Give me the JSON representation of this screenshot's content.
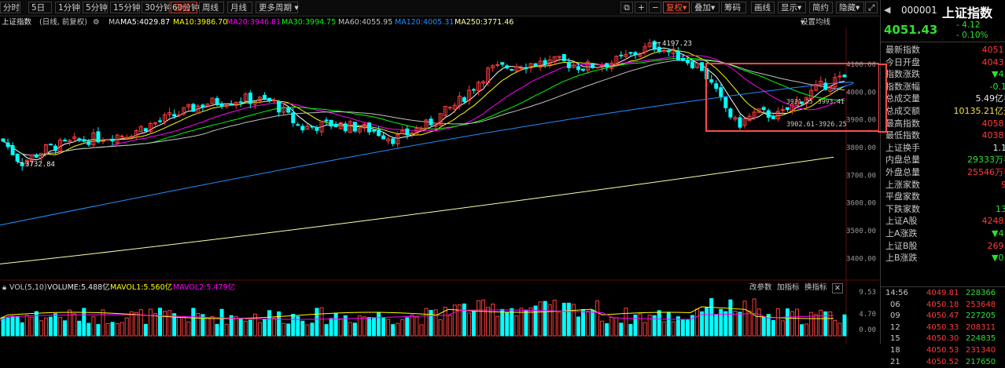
{
  "colors": {
    "up": "#ff3b3b",
    "down": "#00ffff",
    "ma5": "#ffffff",
    "ma10": "#ffff00",
    "ma20": "#ff00ff",
    "ma30": "#00ff00",
    "ma60": "#c0c0c0",
    "ma120": "#1e90ff",
    "ma250": "#ffffaa",
    "frame": "#ff4b4b"
  },
  "toolbar": {
    "periods": [
      "分时",
      "5日",
      "1分钟",
      "5分钟",
      "15分钟",
      "30分钟",
      "60分钟",
      "日线",
      "周线",
      "月线",
      "更多周期"
    ],
    "active_period": "日线",
    "right": [
      "复权",
      "叠加",
      "筹码",
      "画线",
      "显示",
      "简约",
      "隐藏"
    ]
  },
  "legend": {
    "name": "上证指数",
    "mode": "(日线, 前复权)",
    "ma_label": "MA",
    "ma5": "MA5:4029.87",
    "ma10": "MA10:3986.70",
    "ma20": "MA20:3946.81",
    "ma30": "MA30:3994.75",
    "ma60": "MA60:4055.95",
    "ma120": "MA120:4005.31",
    "ma250": "MA250:3771.46",
    "settings": "设置均线"
  },
  "annotations": {
    "high": "4197.23",
    "low": "3732.84",
    "range": "3902.61-3926.25",
    "box_top": "3931.25",
    "box_right": "3993.41"
  },
  "price_axis": [
    "4100.00",
    "4000.00",
    "3900.00",
    "3800.00",
    "3700.00",
    "3600.00",
    "3500.00",
    "3400.00"
  ],
  "volume": {
    "label": "VOL(5,10)",
    "volume": "VOLUME:5.488亿",
    "mavol1": "MAVOL1:5.560亿",
    "mavol2": "MAVOL2:5.479亿",
    "actions": [
      "改参数",
      "加指标",
      "换指标"
    ],
    "axis": [
      "9.53",
      "4.70",
      "0.00"
    ]
  },
  "quote": {
    "code": "000001",
    "name": "上证指数",
    "price": "4051.43",
    "change": "- 4.12",
    "change_pct": "- 0.10%",
    "rows": [
      {
        "label": "最新指数",
        "value": "4051.4",
        "cls": "red"
      },
      {
        "label": "今日开盘",
        "value": "4043.3",
        "cls": "red"
      },
      {
        "label": "指数涨跌",
        "value": "▼4.1",
        "cls": "green"
      },
      {
        "label": "指数涨幅",
        "value": "-0.10",
        "cls": "green"
      },
      {
        "label": "总成交量",
        "value": "5.49亿手",
        "cls": "white"
      },
      {
        "label": "总成交额",
        "value": "10135.21亿元",
        "cls": "yellow"
      },
      {
        "label": "最高指数",
        "value": "4058.6",
        "cls": "red"
      },
      {
        "label": "最低指数",
        "value": "4038.4",
        "cls": "red"
      },
      {
        "label": "上证换手",
        "value": "1.14",
        "cls": "white"
      },
      {
        "label": "内盘总量",
        "value": "29333万手",
        "cls": "green"
      },
      {
        "label": "外盘总量",
        "value": "25546万手",
        "cls": "red"
      },
      {
        "label": "上涨家数",
        "value": "98",
        "cls": "red"
      },
      {
        "label": "平盘家数",
        "value": "5",
        "cls": "white"
      },
      {
        "label": "下跌家数",
        "value": "133",
        "cls": "green"
      },
      {
        "label": "上证A股",
        "value": "4248.3",
        "cls": "red"
      },
      {
        "label": "上A涨跌",
        "value": "▼4.2",
        "cls": "green"
      },
      {
        "label": "上证B股",
        "value": "269.2",
        "cls": "red"
      },
      {
        "label": "上B涨跌",
        "value": "▼0.1",
        "cls": "green"
      }
    ],
    "ticks": [
      {
        "t": "14:56",
        "p": "4049.81",
        "v": "228366"
      },
      {
        "t": "06",
        "p": "4050.18",
        "v": "253648"
      },
      {
        "t": "09",
        "p": "4050.47",
        "v": "227205"
      },
      {
        "t": "12",
        "p": "4050.33",
        "v": "208311"
      },
      {
        "t": "15",
        "p": "4050.30",
        "v": "224835"
      },
      {
        "t": "18",
        "p": "4050.53",
        "v": "231340"
      },
      {
        "t": "21",
        "p": "4050.52",
        "v": "217650"
      }
    ]
  }
}
